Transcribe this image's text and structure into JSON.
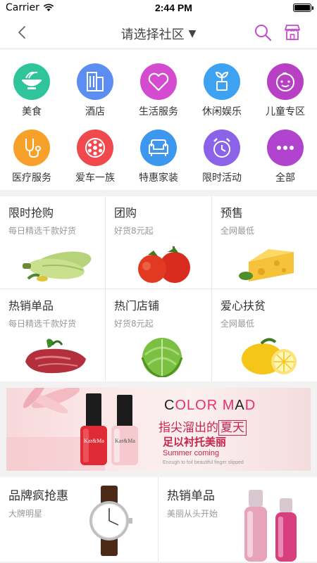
{
  "status": {
    "carrier": "Carrier",
    "time": "2:44 PM"
  },
  "nav": {
    "title": "请选择社区",
    "caret": "▼"
  },
  "categories": [
    {
      "label": "美食",
      "icon": "noodle-bowl-icon",
      "color": "#2fc59a"
    },
    {
      "label": "酒店",
      "icon": "building-icon",
      "color": "#5b8ef0"
    },
    {
      "label": "生活服务",
      "icon": "heart-icon",
      "color": "#d44bd0"
    },
    {
      "label": "休闲娱乐",
      "icon": "plant-icon",
      "color": "#3ea2f2"
    },
    {
      "label": "儿童专区",
      "icon": "baby-face-icon",
      "color": "#b740c4"
    },
    {
      "label": "医疗服务",
      "icon": "stethoscope-icon",
      "color": "#f7a12a"
    },
    {
      "label": "爱车一族",
      "icon": "wheel-icon",
      "color": "#f0494d"
    },
    {
      "label": "特惠家装",
      "icon": "sofa-icon",
      "color": "#3e97ee"
    },
    {
      "label": "限时活动",
      "icon": "alarm-clock-icon",
      "color": "#8a63e8"
    },
    {
      "label": "全部",
      "icon": "more-dots-icon",
      "color": "#b144cf"
    }
  ],
  "grid": [
    {
      "title": "限时抢购",
      "sub": "每日精选千款好货",
      "image": "zucchini"
    },
    {
      "title": "团购",
      "sub": "好货8元起",
      "image": "tomatoes"
    },
    {
      "title": "预售",
      "sub": "全网最低",
      "image": "cheese"
    },
    {
      "title": "热销单品",
      "sub": "每日精选千款好货",
      "image": "meat"
    },
    {
      "title": "热门店铺",
      "sub": "好货8元起",
      "image": "cabbage"
    },
    {
      "title": "爱心扶贫",
      "sub": "全网最低",
      "image": "lemon"
    }
  ],
  "banner": {
    "brand_a": "C",
    "brand_b": "OLOR M",
    "brand_c": "A",
    "brand_d": "D",
    "line1_a": "指尖溜出的",
    "line1_b": "夏天",
    "line2": "足以衬托美丽",
    "line3": "Summer coming",
    "line4": "Enough to foil beautiful finger slipped",
    "bottle_label": "Kar&Ma"
  },
  "bottom": [
    {
      "title": "品牌疯抢惠",
      "sub": "大牌明星",
      "image": "watch"
    },
    {
      "title": "热销单品",
      "sub": "美丽从头开始",
      "image": "cosmetics"
    }
  ]
}
